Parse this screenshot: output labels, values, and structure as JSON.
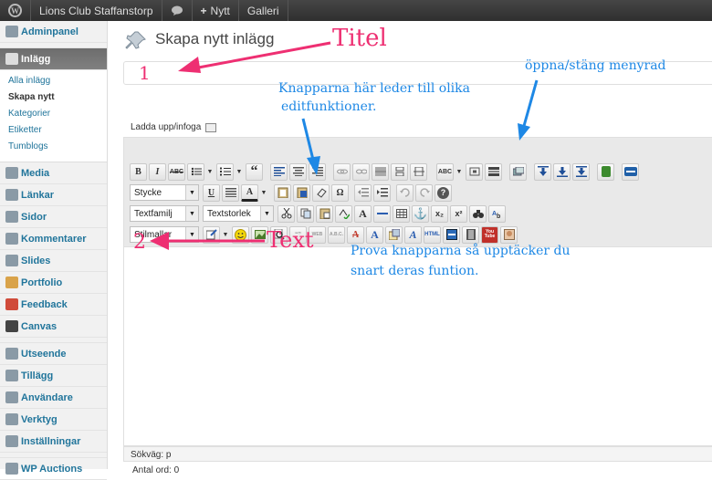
{
  "adminbar": {
    "site_name": "Lions Club Staffanstorp",
    "new_label": "Nytt",
    "gallery_label": "Galleri",
    "new_plus": "+"
  },
  "sidebar": {
    "dashboard": "Adminpanel",
    "posts": "Inlägg",
    "posts_sub": [
      "Alla inlägg",
      "Skapa nytt",
      "Kategorier",
      "Etiketter",
      "Tumblogs"
    ],
    "items_a": [
      "Media",
      "Länkar",
      "Sidor",
      "Kommentarer",
      "Slides",
      "Portfolio",
      "Feedback",
      "Canvas"
    ],
    "items_b": [
      "Utseende",
      "Tillägg",
      "Användare",
      "Verktyg",
      "Inställningar"
    ],
    "items_c": [
      "WP Auctions"
    ]
  },
  "page": {
    "title": "Skapa nytt inlägg"
  },
  "editor": {
    "upload_label": "Ladda upp/infoga",
    "format_select": "Stycke",
    "font_family_select": "Textfamilj",
    "font_size_select": "Textstorlek",
    "styles_select": "Stilmallar",
    "path_label": "Sökväg: p",
    "word_count": "Antal ord: 0",
    "buttons": {
      "bold": "B",
      "italic": "I",
      "strike": "ABC",
      "quote": "“",
      "underline": "U",
      "text_color": "A",
      "omega": "Ω",
      "anchor": "⚓",
      "sub": "x₂",
      "sup": "x²",
      "search": "🔍",
      "html": "HTML",
      "video": "You Tube",
      "help": "?"
    }
  },
  "annotations": {
    "titel": "Titel",
    "num1": "1",
    "meny": "öppna/stäng menyrad",
    "knappar_line1": "Knapparna här leder till olika",
    "knappar_line2": "editfunktioner.",
    "num2": "2",
    "text": "Text",
    "prova_line1": "Prova knapparna så upptäcker du",
    "prova_line2": "snart deras funtion."
  },
  "colors": {
    "annotation_pink": "#ee2f72",
    "annotation_blue": "#1e88e5",
    "link_blue": "#21759b"
  }
}
